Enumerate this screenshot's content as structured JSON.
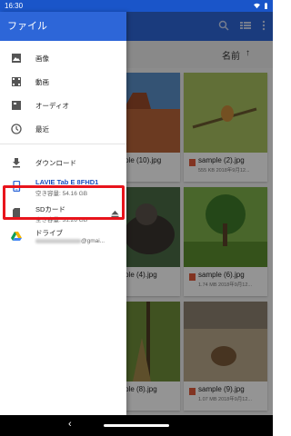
{
  "status_bar": {
    "time": "16:30"
  },
  "drawer": {
    "title": "ファイル",
    "items": [
      {
        "label": "画像",
        "icon": "image-icon"
      },
      {
        "label": "動画",
        "icon": "video-icon"
      },
      {
        "label": "オーディオ",
        "icon": "audio-icon"
      },
      {
        "label": "最近",
        "icon": "clock-icon"
      },
      {
        "label": "ダウンロード",
        "icon": "download-icon"
      }
    ],
    "devices": [
      {
        "label": "LAVIE Tab E 8FHD1",
        "sub": "空き容量: 54.16 GB",
        "icon": "tablet-icon"
      },
      {
        "label": "SDカード",
        "sub": "空き容量: 31.26 GB",
        "icon": "sd-card-icon",
        "highlighted": true
      },
      {
        "label": "ドライブ",
        "sub_suffix": "@gmai...",
        "icon": "google-drive-icon"
      }
    ]
  },
  "background": {
    "sort_label": "名前",
    "files": [
      {
        "name": "sample (10).jpg",
        "meta": ""
      },
      {
        "name": "sample (2).jpg",
        "meta": "555 KB 2018年9月12..."
      },
      {
        "name": "sample (4).jpg",
        "meta": ""
      },
      {
        "name": "sample (6).jpg",
        "meta": "1.74 MB 2018年9月12..."
      },
      {
        "name": "sample (8).jpg",
        "meta": ""
      },
      {
        "name": "sample (9).jpg",
        "meta": "1.07 MB 2018年9月12..."
      }
    ]
  },
  "colors": {
    "header_blue": "#2d66d8",
    "status_blue": "#1a55c9",
    "highlight_red": "#e8141c",
    "device_label_blue": "#1a4fbf"
  }
}
